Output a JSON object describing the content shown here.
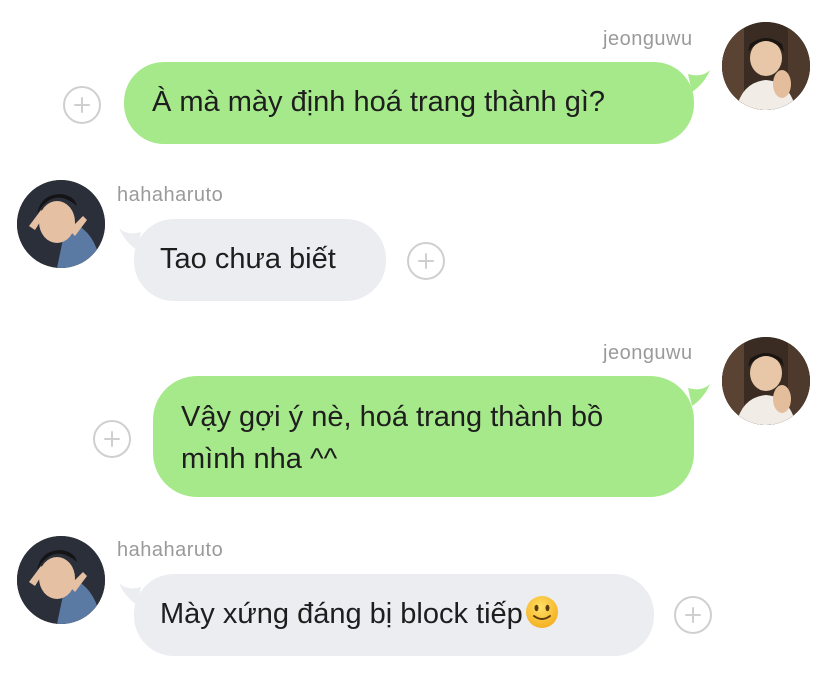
{
  "messages": [
    {
      "sender": "jeonguwu",
      "direction": "sent",
      "text": "À mà mày định hoá trang thành gì?"
    },
    {
      "sender": "hahaharuto",
      "direction": "received",
      "text": "Tao chưa biết"
    },
    {
      "sender": "jeonguwu",
      "direction": "sent",
      "line1": "Vậy gợi ý nè, hoá trang thành bồ",
      "line2": "mình nha ^^"
    },
    {
      "sender": "hahaharuto",
      "direction": "received",
      "text": "Mày xứng đáng bị block tiếp"
    }
  ],
  "colors": {
    "sent_bubble": "#a6e98a",
    "received_bubble": "#ebedf0",
    "username": "#9a9a9a",
    "plus_border": "#cfcfcf"
  },
  "icons": {
    "add": "plus-circle-icon",
    "emoji": "slightly-smiling-face-icon"
  }
}
